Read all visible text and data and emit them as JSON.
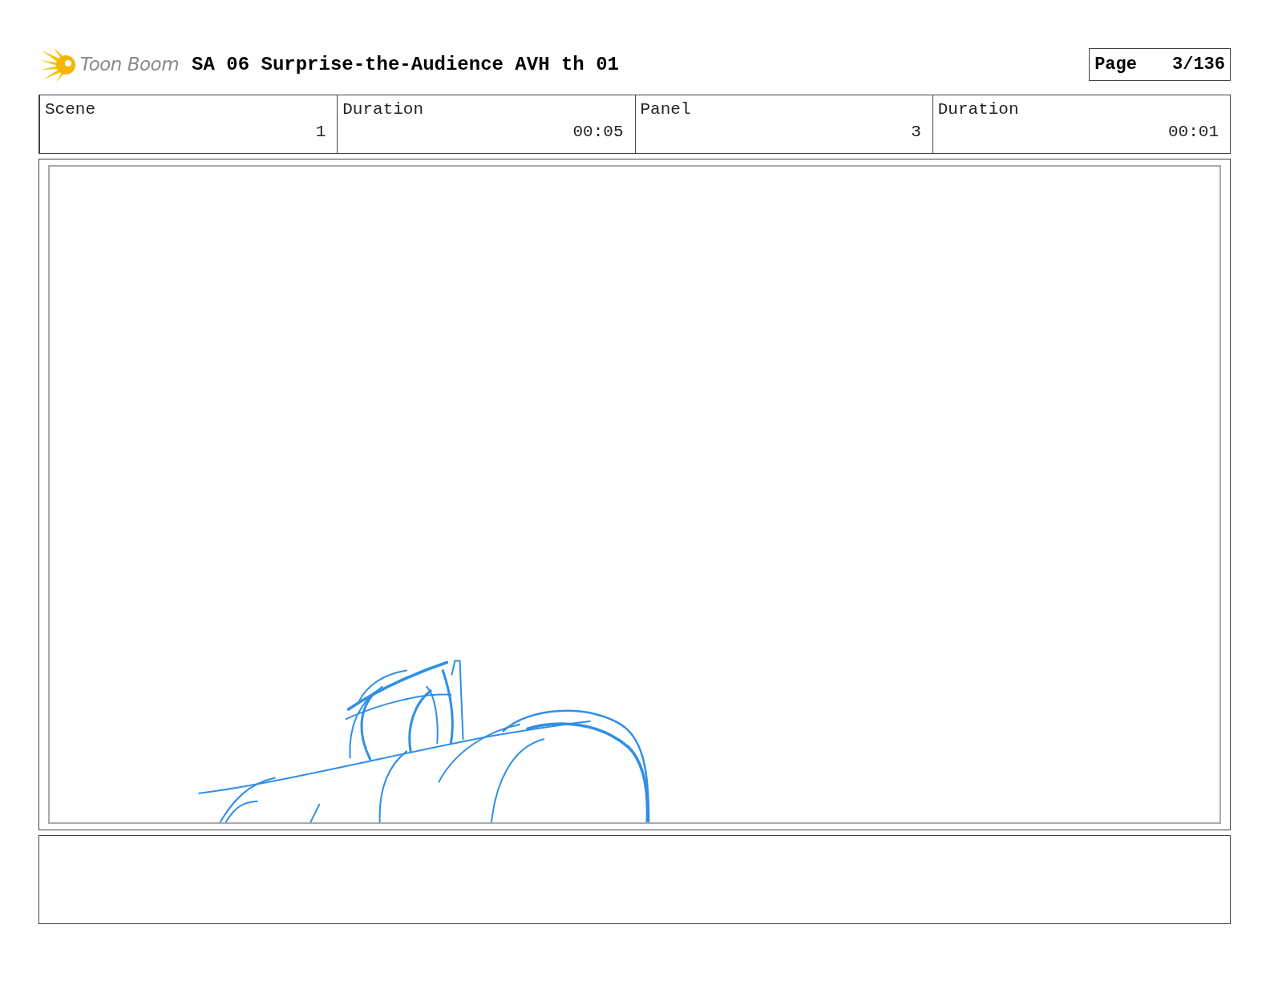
{
  "logo": {
    "text": "Toon Boom"
  },
  "title": "SA 06 Surprise-the-Audience AVH th 01",
  "page": {
    "label": "Page",
    "value": "3/136"
  },
  "fields": [
    {
      "label": "Scene",
      "value": "1"
    },
    {
      "label": "Duration",
      "value": "00:05"
    },
    {
      "label": "Panel",
      "value": "3"
    },
    {
      "label": "Duration",
      "value": "00:01"
    }
  ]
}
